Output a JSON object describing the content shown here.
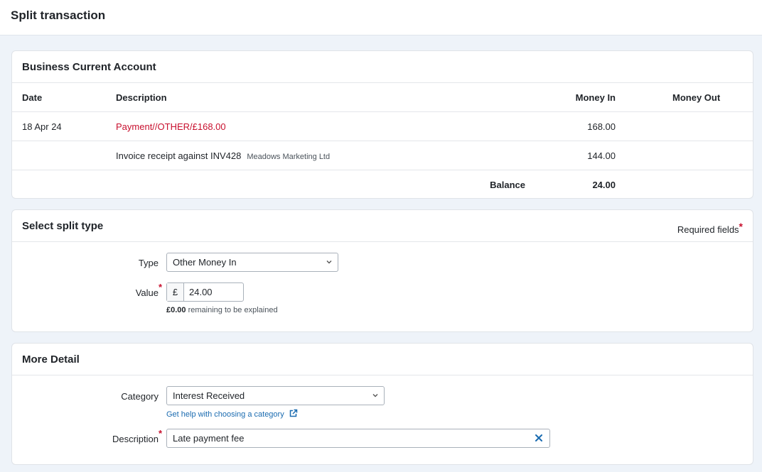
{
  "page": {
    "title": "Split transaction"
  },
  "account": {
    "title": "Business Current Account",
    "columns": {
      "date": "Date",
      "description": "Description",
      "money_in": "Money In",
      "money_out": "Money Out"
    },
    "rows": [
      {
        "date": "18 Apr 24",
        "description": "Payment//OTHER/£168.00",
        "money_in": "168.00",
        "money_out": ""
      },
      {
        "date": "",
        "description": "Invoice receipt against INV428",
        "meta": "Meadows Marketing Ltd",
        "money_in": "144.00",
        "money_out": ""
      }
    ],
    "balance_label": "Balance",
    "balance_value": "24.00"
  },
  "split": {
    "title": "Select split type",
    "required_note": "Required fields",
    "required_star": "*",
    "type_label": "Type",
    "type_value": "Other Money In",
    "value_label": "Value",
    "currency_symbol": "£",
    "value": "24.00",
    "remaining_amount": "£0.00",
    "remaining_text": "remaining to be explained"
  },
  "detail": {
    "title": "More Detail",
    "category_label": "Category",
    "category_value": "Interest Received",
    "help_link": "Get help with choosing a category",
    "description_label": "Description",
    "description_value": "Late payment fee"
  },
  "colors": {
    "accent_red": "#c8102e",
    "link_blue": "#1a6bb0"
  }
}
